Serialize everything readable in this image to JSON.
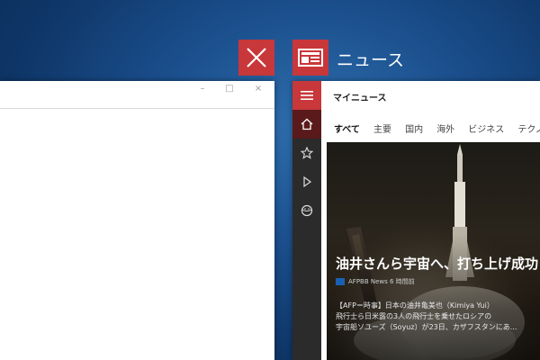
{
  "close_button": {
    "icon": "close-icon"
  },
  "app": {
    "title": "ニュース",
    "icon": "news-app-icon",
    "section_title": "マイニュース"
  },
  "left_window": {
    "controls": [
      "–",
      "□",
      "×"
    ]
  },
  "tabs": [
    "すべて",
    "主要",
    "国内",
    "海外",
    "ビジネス",
    "テクノロジ"
  ],
  "nav": {
    "items": [
      "hamburger-icon",
      "home-icon",
      "favorites-icon",
      "play-icon",
      "globe-icon"
    ]
  },
  "article": {
    "headline": "油井さんら宇宙へ、打ち上げ成功",
    "source": "AFPBB News",
    "time": "6 時間前",
    "summary_lines": [
      "【AFP＝時事】日本の油井亀美也（Kimiya Yui）",
      "飛行士ら日米露の3人の飛行士を乗せたロシアの",
      "宇宙船ソユーズ（Soyuz）が23日、カザフスタンにあ..."
    ]
  },
  "colors": {
    "accent": "#c8373a",
    "rail": "#2b2b2b",
    "rail_active": "#5a1a1b",
    "desktop": "#1b4f8d"
  }
}
